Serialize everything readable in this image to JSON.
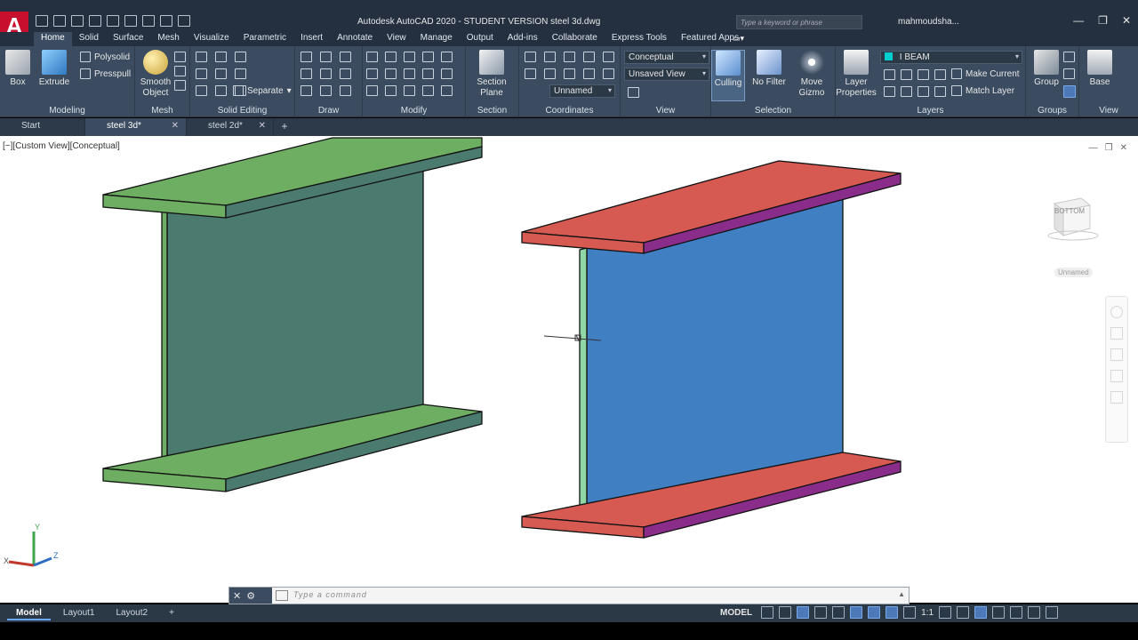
{
  "window": {
    "title": "Autodesk AutoCAD 2020 - STUDENT VERSION    steel 3d.dwg",
    "app_logo": "A",
    "search_placeholder": "Type a keyword or phrase",
    "user": "mahmoudsha..."
  },
  "ribbon_tabs": [
    "Home",
    "Solid",
    "Surface",
    "Mesh",
    "Visualize",
    "Parametric",
    "Insert",
    "Annotate",
    "View",
    "Manage",
    "Output",
    "Add-ins",
    "Collaborate",
    "Express Tools",
    "Featured Apps"
  ],
  "active_tab": "Home",
  "panels": {
    "modeling": {
      "title": "Modeling",
      "box": "Box",
      "extrude": "Extrude",
      "polysolid": "Polysolid",
      "presspull": "Presspull"
    },
    "mesh": {
      "title": "Mesh",
      "smooth_object": "Smooth Object"
    },
    "solid_editing": {
      "title": "Solid Editing",
      "separate": "Separate"
    },
    "draw": {
      "title": "Draw"
    },
    "modify": {
      "title": "Modify"
    },
    "section": {
      "title": "Section",
      "section_plane": "Section Plane"
    },
    "coordinates": {
      "title": "Coordinates",
      "ucs_name": "Unnamed"
    },
    "view": {
      "title": "View",
      "visual_style": "Conceptual",
      "saved_view": "Unsaved View"
    },
    "selection": {
      "title": "Selection",
      "culling": "Culling",
      "no_filter": "No Filter",
      "move_gizmo": "Move Gizmo"
    },
    "layers": {
      "title": "Layers",
      "layer_properties": "Layer Properties",
      "current_layer": "I BEAM",
      "make_current": "Make Current",
      "match_layer": "Match Layer"
    },
    "groups": {
      "title": "Groups",
      "group": "Group"
    },
    "view2": {
      "title": "View",
      "base": "Base"
    }
  },
  "doc_tabs": [
    {
      "label": "Start"
    },
    {
      "label": "steel 3d*"
    },
    {
      "label": "steel 2d*"
    }
  ],
  "active_doc": "steel 3d*",
  "viewport": {
    "label": "[−][Custom View][Conceptual]",
    "viewcube_face": "BOTTOM",
    "wcs_label": "Unnamed",
    "colors": {
      "left_beam_face": "#6dae63",
      "left_beam_web": "#4b7a6f",
      "right_flange_top": "#d65a52",
      "right_flange_side": "#8a2c8a",
      "right_web": "#3f7fc2",
      "right_web_edge": "#8fd8a5"
    }
  },
  "ucs": {
    "x": "X",
    "y": "Y",
    "z": "Z"
  },
  "command_line": {
    "placeholder": "Type  a  command"
  },
  "layout_tabs": [
    "Model",
    "Layout1",
    "Layout2"
  ],
  "active_layout": "Model",
  "status": {
    "space": "MODEL",
    "scale": "1:1"
  }
}
